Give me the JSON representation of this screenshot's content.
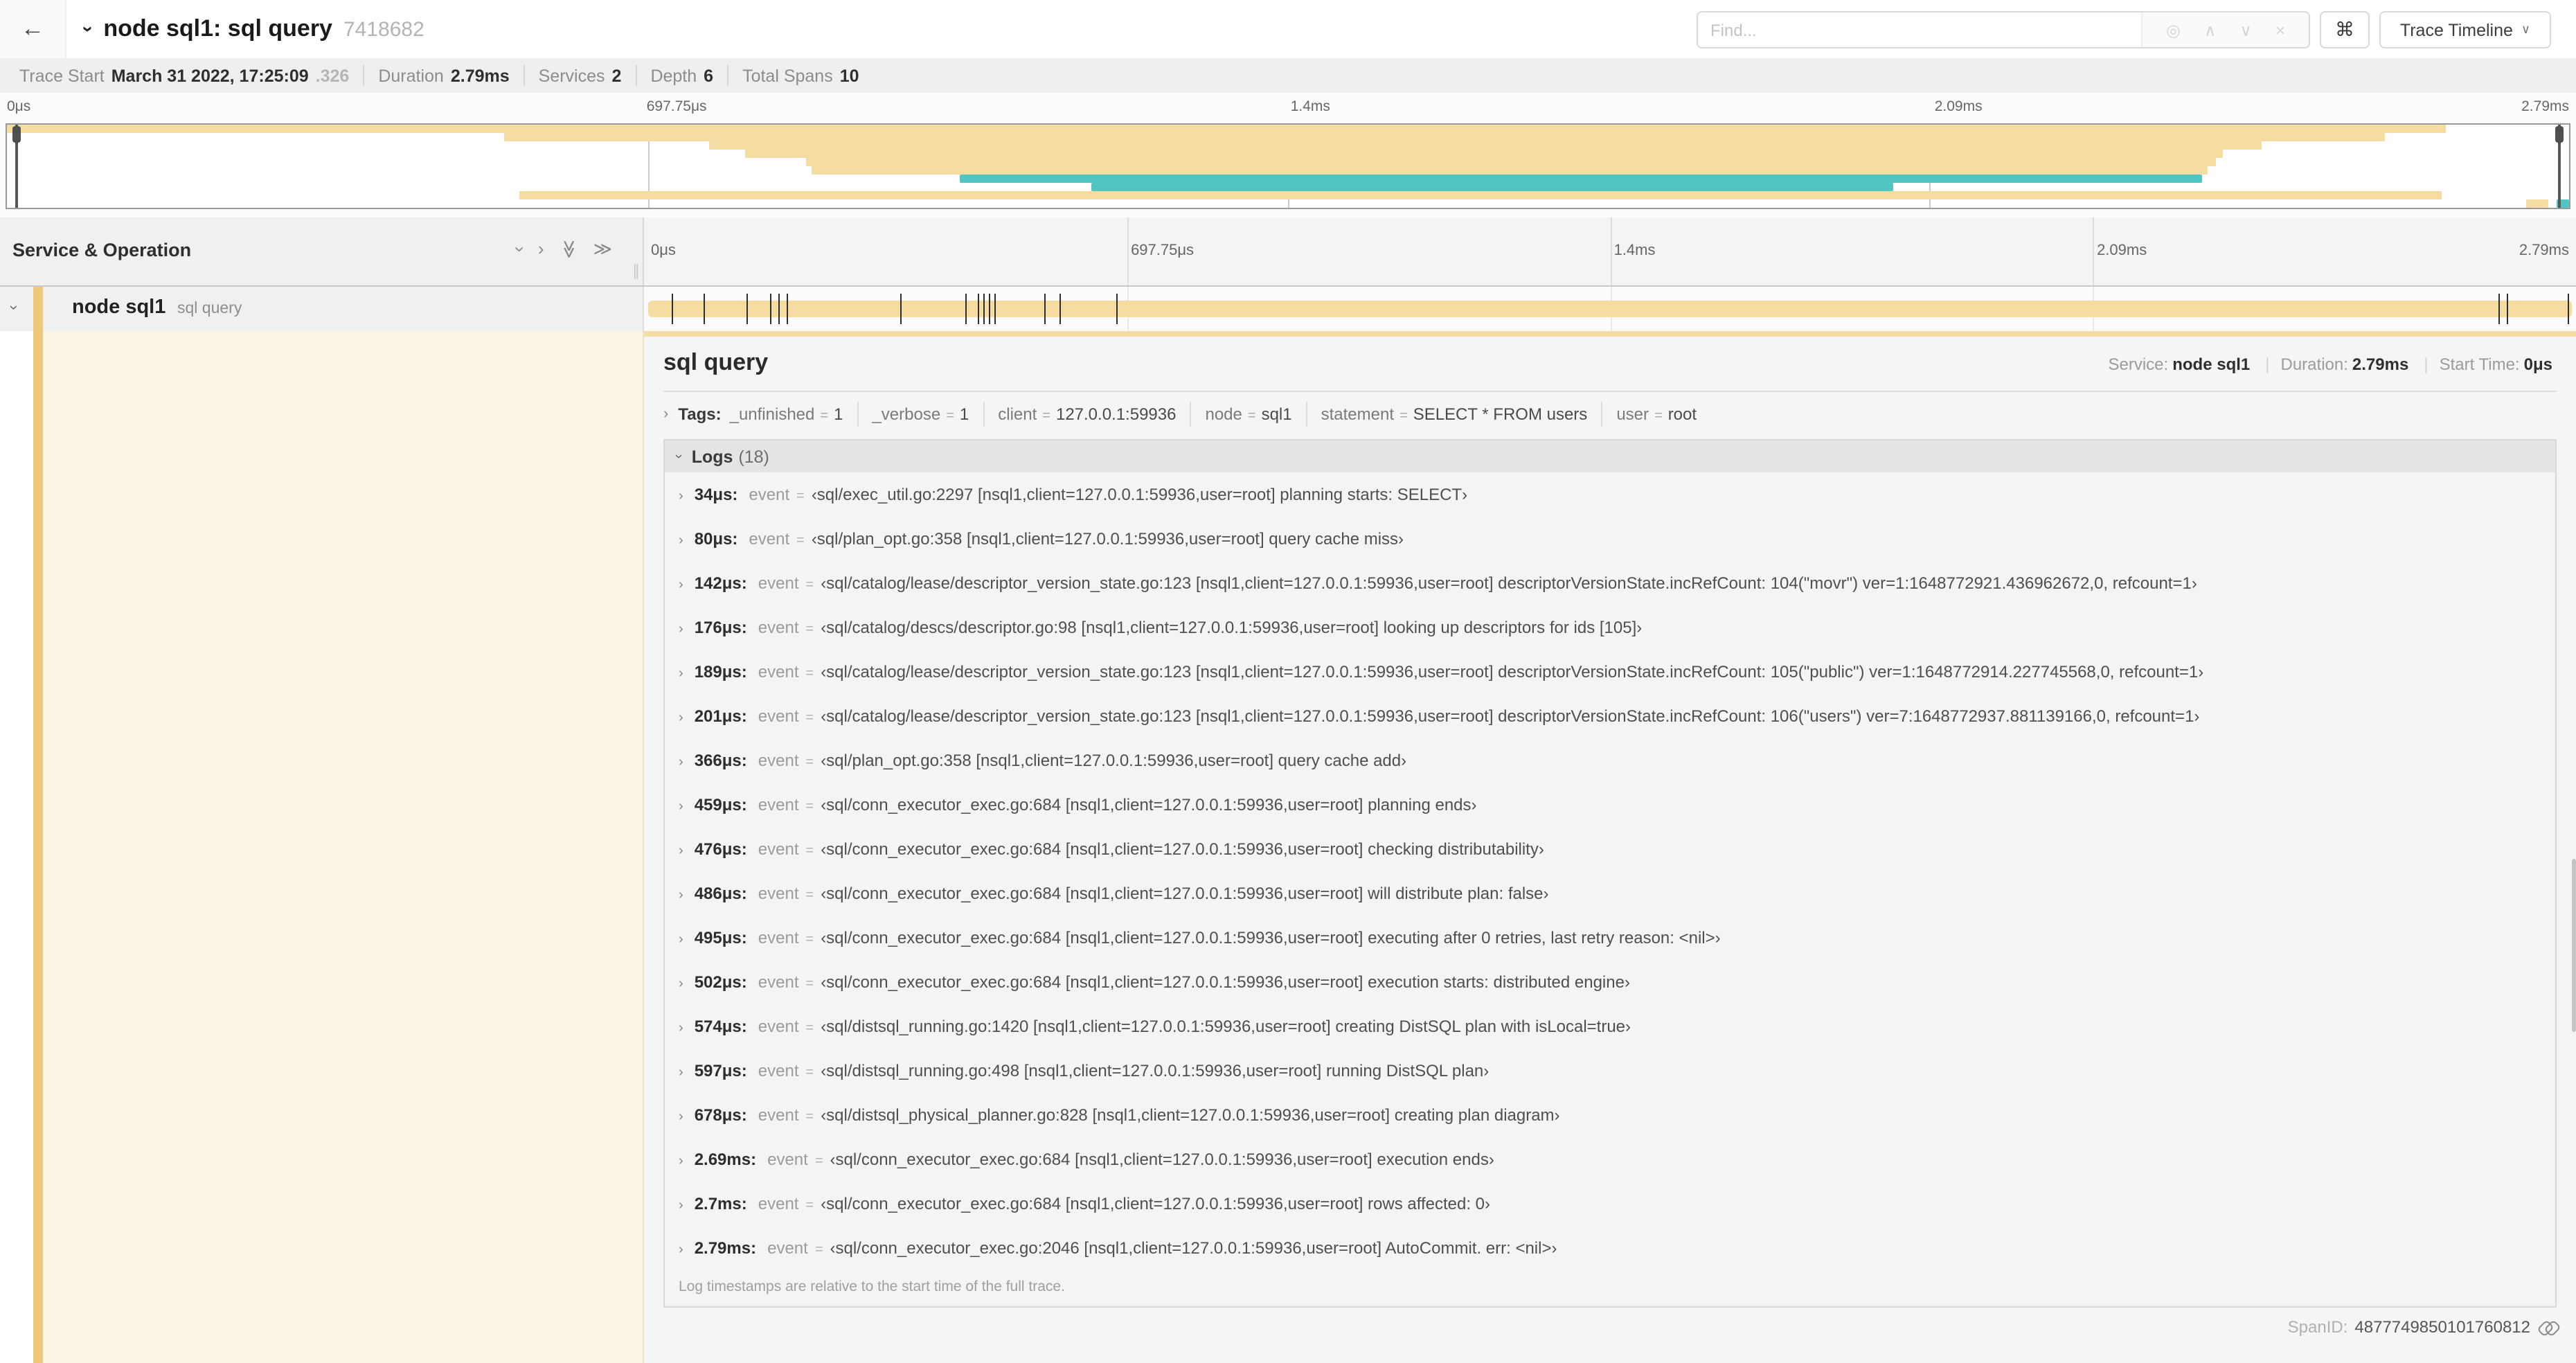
{
  "colors": {
    "span": "#F5DCA1",
    "accent": "#EFC878",
    "teal": "#4FC5C4",
    "cream": "#FBF4E6"
  },
  "icons": {
    "back": "←",
    "collapse": "›",
    "target": "◎",
    "up": "∧",
    "down": "∨",
    "close": "×",
    "command": "⌘",
    "dropdown": "∨",
    "chev_right": "›",
    "chev_double": "≫",
    "grip": "∥"
  },
  "header": {
    "title": "node sql1: sql query",
    "trace_id_short": "7418682",
    "find_placeholder": "Find...",
    "view_selector": "Trace Timeline"
  },
  "summary": {
    "items": [
      {
        "label": "Trace Start",
        "value": "March 31 2022, 17:25:09",
        "suffix": ".326"
      },
      {
        "label": "Duration",
        "value": "2.79ms",
        "suffix": ""
      },
      {
        "label": "Services",
        "value": "2",
        "suffix": ""
      },
      {
        "label": "Depth",
        "value": "6",
        "suffix": ""
      },
      {
        "label": "Total Spans",
        "value": "10",
        "suffix": ""
      }
    ]
  },
  "minimap": {
    "ticks": [
      "0μs",
      "697.75μs",
      "1.4ms",
      "2.09ms",
      "2.79ms"
    ],
    "spans": [
      {
        "row": 0,
        "start": 0,
        "end": 95.2,
        "c": "span"
      },
      {
        "row": 1,
        "start": 19.4,
        "end": 92.8,
        "c": "span"
      },
      {
        "row": 2,
        "start": 27.4,
        "end": 88.0,
        "c": "span"
      },
      {
        "row": 3,
        "start": 28.8,
        "end": 86.5,
        "c": "span"
      },
      {
        "row": 4,
        "start": 31.2,
        "end": 86.2,
        "c": "span"
      },
      {
        "row": 5,
        "start": 31.4,
        "end": 85.9,
        "c": "span"
      },
      {
        "row": 6,
        "start": 37.2,
        "end": 85.7,
        "c": "teal"
      },
      {
        "row": 7,
        "start": 42.3,
        "end": 73.6,
        "c": "teal"
      },
      {
        "row": 8,
        "start": 20.0,
        "end": 95.0,
        "c": "span"
      },
      {
        "row": 9,
        "start": 98.3,
        "end": 99.2,
        "c": "span"
      },
      {
        "row": 9,
        "start": 99.5,
        "end": 100,
        "c": "teal"
      }
    ]
  },
  "timeline": {
    "column_header": "Service & Operation",
    "ticks": [
      "0μs",
      "697.75μs",
      "1.4ms",
      "2.09ms",
      "2.79ms"
    ],
    "row": {
      "service": "node sql1",
      "operation": "sql query"
    },
    "log_marker_pcts": [
      1.2,
      2.9,
      5.1,
      6.3,
      6.8,
      7.2,
      13.1,
      16.5,
      17.1,
      17.4,
      17.7,
      18.0,
      20.6,
      21.4,
      24.3,
      96.2,
      96.6,
      99.8
    ]
  },
  "detail": {
    "operation": "sql query",
    "service_label": "Service:",
    "service": "node sql1",
    "duration_label": "Duration:",
    "duration": "2.79ms",
    "start_label": "Start Time:",
    "start": "0μs",
    "tags_label": "Tags:",
    "tags_eq": "=",
    "tags": [
      {
        "key": "_unfinished",
        "value": "1"
      },
      {
        "key": "_verbose",
        "value": "1"
      },
      {
        "key": "client",
        "value": "127.0.0.1:59936"
      },
      {
        "key": "node",
        "value": "sql1"
      },
      {
        "key": "statement",
        "value": "SELECT * FROM users"
      },
      {
        "key": "user",
        "value": "root"
      }
    ],
    "logs_label": "Logs",
    "logs_count": "(18)",
    "log_field_label": "event",
    "log_eq": "=",
    "logs": [
      {
        "t": "34μs:",
        "value": "‹sql/exec_util.go:2297 [nsql1,client=127.0.0.1:59936,user=root] planning starts: SELECT›"
      },
      {
        "t": "80μs:",
        "value": "‹sql/plan_opt.go:358 [nsql1,client=127.0.0.1:59936,user=root] query cache miss›"
      },
      {
        "t": "142μs:",
        "value": "‹sql/catalog/lease/descriptor_version_state.go:123 [nsql1,client=127.0.0.1:59936,user=root] descriptorVersionState.incRefCount: 104(\"movr\") ver=1:1648772921.436962672,0, refcount=1›"
      },
      {
        "t": "176μs:",
        "value": "‹sql/catalog/descs/descriptor.go:98 [nsql1,client=127.0.0.1:59936,user=root] looking up descriptors for ids [105]›"
      },
      {
        "t": "189μs:",
        "value": "‹sql/catalog/lease/descriptor_version_state.go:123 [nsql1,client=127.0.0.1:59936,user=root] descriptorVersionState.incRefCount: 105(\"public\") ver=1:1648772914.227745568,0, refcount=1›"
      },
      {
        "t": "201μs:",
        "value": "‹sql/catalog/lease/descriptor_version_state.go:123 [nsql1,client=127.0.0.1:59936,user=root] descriptorVersionState.incRefCount: 106(\"users\") ver=7:1648772937.881139166,0, refcount=1›"
      },
      {
        "t": "366μs:",
        "value": "‹sql/plan_opt.go:358 [nsql1,client=127.0.0.1:59936,user=root] query cache add›"
      },
      {
        "t": "459μs:",
        "value": "‹sql/conn_executor_exec.go:684 [nsql1,client=127.0.0.1:59936,user=root] planning ends›"
      },
      {
        "t": "476μs:",
        "value": "‹sql/conn_executor_exec.go:684 [nsql1,client=127.0.0.1:59936,user=root] checking distributability›"
      },
      {
        "t": "486μs:",
        "value": "‹sql/conn_executor_exec.go:684 [nsql1,client=127.0.0.1:59936,user=root] will distribute plan: false›"
      },
      {
        "t": "495μs:",
        "value": "‹sql/conn_executor_exec.go:684 [nsql1,client=127.0.0.1:59936,user=root] executing after 0 retries, last retry reason: <nil>›"
      },
      {
        "t": "502μs:",
        "value": "‹sql/conn_executor_exec.go:684 [nsql1,client=127.0.0.1:59936,user=root] execution starts: distributed engine›"
      },
      {
        "t": "574μs:",
        "value": "‹sql/distsql_running.go:1420 [nsql1,client=127.0.0.1:59936,user=root] creating DistSQL plan with isLocal=true›"
      },
      {
        "t": "597μs:",
        "value": "‹sql/distsql_running.go:498 [nsql1,client=127.0.0.1:59936,user=root] running DistSQL plan›"
      },
      {
        "t": "678μs:",
        "value": "‹sql/distsql_physical_planner.go:828 [nsql1,client=127.0.0.1:59936,user=root] creating plan diagram›"
      },
      {
        "t": "2.69ms:",
        "value": "‹sql/conn_executor_exec.go:684 [nsql1,client=127.0.0.1:59936,user=root] execution ends›"
      },
      {
        "t": "2.7ms:",
        "value": "‹sql/conn_executor_exec.go:684 [nsql1,client=127.0.0.1:59936,user=root] rows affected: 0›"
      },
      {
        "t": "2.79ms:",
        "value": "‹sql/conn_executor_exec.go:2046 [nsql1,client=127.0.0.1:59936,user=root] AutoCommit. err: <nil>›"
      }
    ],
    "logs_note": "Log timestamps are relative to the start time of the full trace.",
    "spanid_label": "SpanID:",
    "spanid": "4877749850101760812"
  }
}
